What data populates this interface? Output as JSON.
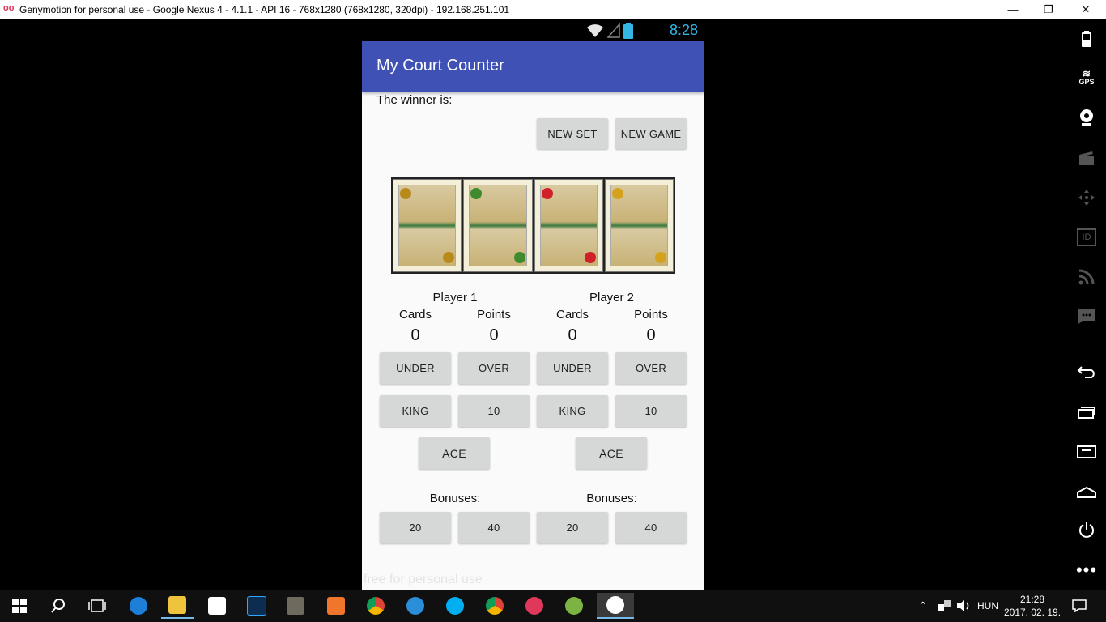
{
  "window": {
    "title": "Genymotion for personal use - Google Nexus 4 - 4.1.1 - API 16 - 768x1280 (768x1280, 320dpi) - 192.168.251.101",
    "logo": "oo",
    "minimize": "—",
    "restore": "❐",
    "close": "✕"
  },
  "device": {
    "clock": "8:28",
    "watermark": "free for personal use"
  },
  "app": {
    "title": "My Court Counter",
    "winner_label": "The winner is:",
    "new_set": "NEW SET",
    "new_game": "NEW GAME",
    "players": [
      {
        "name": "Player 1",
        "cards_label": "Cards",
        "points_label": "Points",
        "cards": "0",
        "points": "0",
        "under": "UNDER",
        "over": "OVER",
        "king": "KING",
        "ten": "10",
        "ace": "ACE",
        "bonuses_label": "Bonuses:",
        "bonus20": "20",
        "bonus40": "40"
      },
      {
        "name": "Player 2",
        "cards_label": "Cards",
        "points_label": "Points",
        "cards": "0",
        "points": "0",
        "under": "UNDER",
        "over": "OVER",
        "king": "KING",
        "ten": "10",
        "ace": "ACE",
        "bonuses_label": "Bonuses:",
        "bonus20": "20",
        "bonus40": "40"
      }
    ]
  },
  "sidebar": {
    "gps_label": "GPS",
    "id_label": "ID"
  },
  "taskbar": {
    "language": "HUN",
    "time": "21:28",
    "date": "2017. 02. 19."
  },
  "colors": {
    "appbar": "#3f51b5",
    "status_clock": "#33b5e5",
    "button": "#d6d7d7"
  }
}
